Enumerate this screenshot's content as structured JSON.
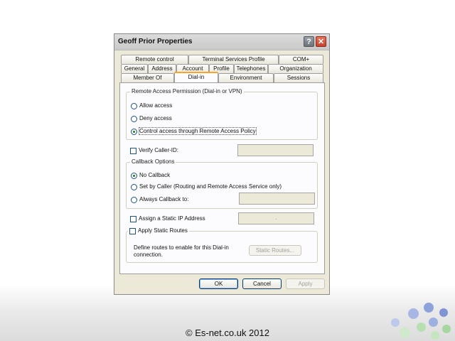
{
  "dialog": {
    "title": "Geoff Prior Properties",
    "help_glyph": "?",
    "close_glyph": "✕"
  },
  "tabs": {
    "row1": [
      "Remote control",
      "Terminal Services Profile",
      "COM+"
    ],
    "row2": [
      "General",
      "Address",
      "Account",
      "Profile",
      "Telephones",
      "Organization"
    ],
    "row3": [
      "Member Of",
      "Dial-in",
      "Environment",
      "Sessions"
    ],
    "active": "Dial-in"
  },
  "remote_access": {
    "group_title": "Remote Access Permission (Dial-in or VPN)",
    "options": [
      "Allow access",
      "Deny access",
      "Control access through Remote Access Policy"
    ],
    "selected": "Control access through Remote Access Policy"
  },
  "verify_caller_id": {
    "label": "Verify Caller-ID:",
    "checked": false,
    "value": ""
  },
  "callback": {
    "group_title": "Callback Options",
    "options": [
      "No Callback",
      "Set by Caller (Routing and Remote Access Service only)",
      "Always Callback to:"
    ],
    "selected": "No Callback",
    "always_value": ""
  },
  "static_ip": {
    "label": "Assign a Static IP Address",
    "checked": false,
    "value": "."
  },
  "static_routes": {
    "label": "Apply Static Routes",
    "checked": false,
    "description": "Define routes to enable for this Dial-in connection.",
    "button": "Static Routes..."
  },
  "buttons": {
    "ok": "OK",
    "cancel": "Cancel",
    "apply": "Apply"
  },
  "footer": {
    "copyright": "© Es-net.co.uk 2012"
  },
  "colors": {
    "dialog_bg": "#ece9d8",
    "panel_bg": "#fcfcfe",
    "active_tab_accent": "#f5a623",
    "close_button": "#c6432b"
  }
}
